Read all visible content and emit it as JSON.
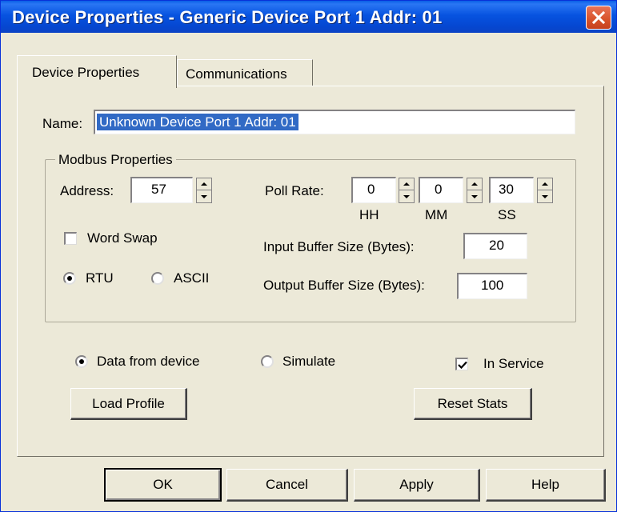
{
  "window": {
    "title": "Device Properties - Generic Device Port 1  Addr: 01"
  },
  "tabs": [
    {
      "label": "Device Properties"
    },
    {
      "label": "Communications"
    }
  ],
  "name_field": {
    "label": "Name:",
    "value": "Unknown Device Port 1  Addr: 01"
  },
  "modbus": {
    "group_label": "Modbus Properties",
    "address_label": "Address:",
    "address_value": "57",
    "word_swap_label": "Word Swap",
    "word_swap_checked": false,
    "rtu_label": "RTU",
    "ascii_label": "ASCII",
    "mode_selected": "RTU",
    "poll_rate_label": "Poll Rate:",
    "poll_hh": "0",
    "poll_mm": "0",
    "poll_ss": "30",
    "hh_label": "HH",
    "mm_label": "MM",
    "ss_label": "SS",
    "input_buffer_label": "Input Buffer Size (Bytes):",
    "input_buffer_value": "20",
    "output_buffer_label": "Output Buffer Size (Bytes):",
    "output_buffer_value": "100"
  },
  "source": {
    "data_from_device_label": "Data from device",
    "simulate_label": "Simulate",
    "selected": "Data from device"
  },
  "in_service": {
    "label": "In Service",
    "checked": true
  },
  "buttons": {
    "load_profile": "Load Profile",
    "reset_stats": "Reset Stats",
    "ok": "OK",
    "cancel": "Cancel",
    "apply": "Apply",
    "help": "Help"
  },
  "colors": {
    "titlebar": "#0753e0",
    "selection": "#316ac5",
    "face": "#ece9d8",
    "close_button": "#d9542c"
  }
}
